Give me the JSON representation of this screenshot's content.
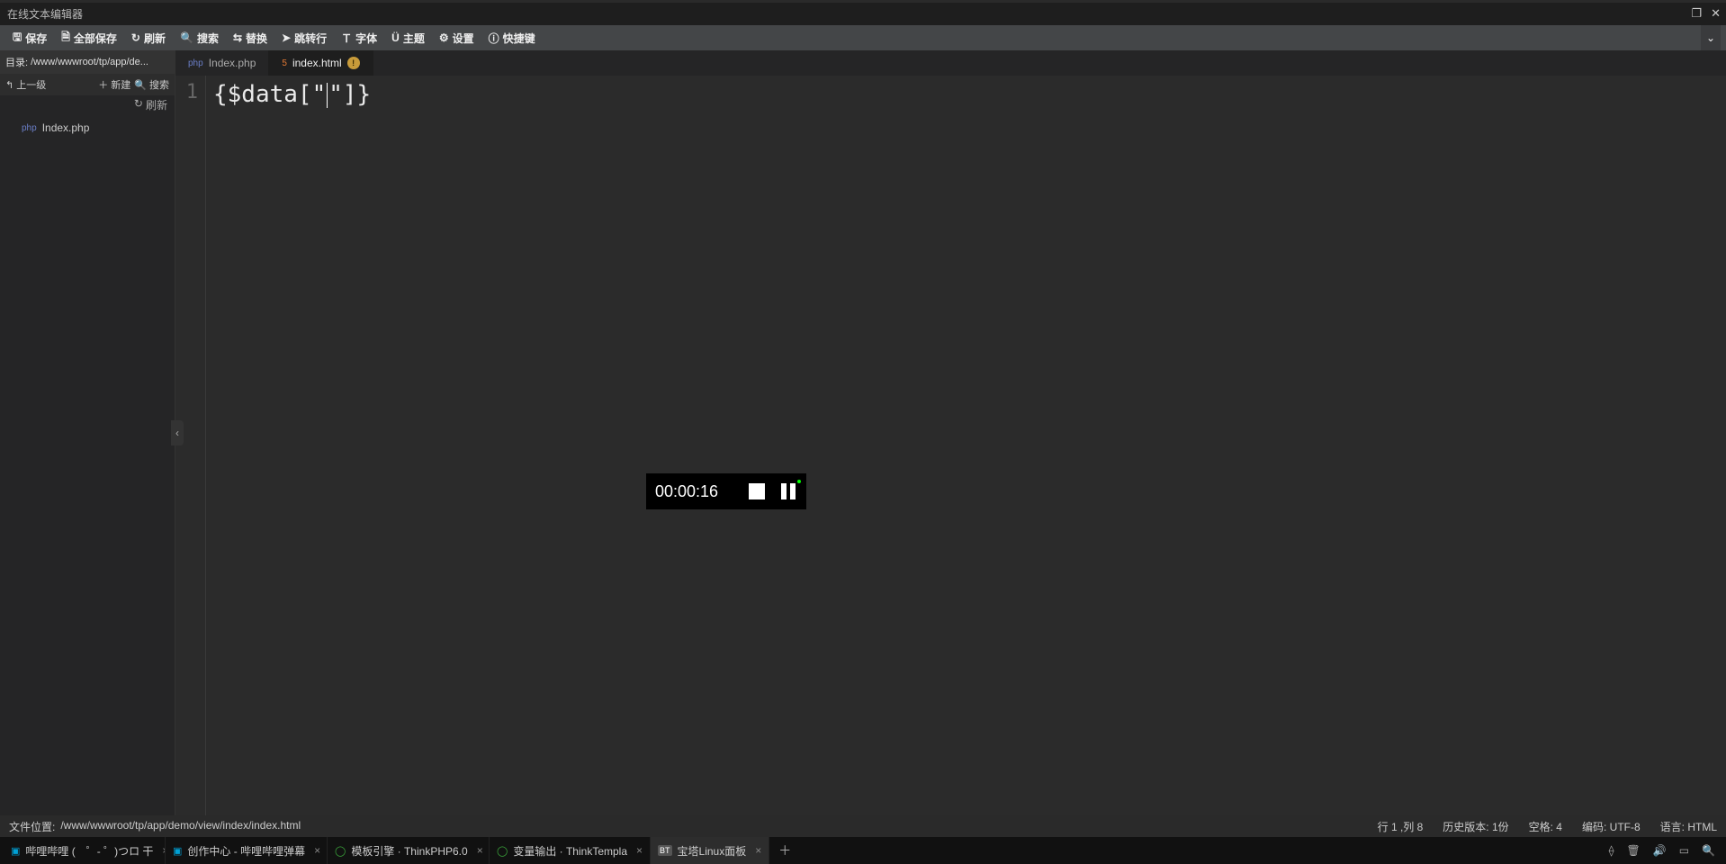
{
  "window": {
    "title": "在线文本编辑器"
  },
  "toolbar": {
    "save": "保存",
    "save_all": "全部保存",
    "refresh": "刷新",
    "search": "搜索",
    "replace": "替换",
    "goto": "跳转行",
    "font": "字体",
    "theme": "主题",
    "settings": "设置",
    "shortcuts": "快捷键"
  },
  "sidebar": {
    "dir_label": "目录:",
    "dir_path": "/www/wwwroot/tp/app/de...",
    "up": "上一级",
    "new": "新建",
    "search": "搜索",
    "refresh": "刷新",
    "files": [
      {
        "name": "Index.php",
        "type": "php"
      }
    ]
  },
  "tabs": [
    {
      "name": "Index.php",
      "type": "php",
      "active": false,
      "dirty": false
    },
    {
      "name": "index.html",
      "type": "html",
      "active": true,
      "dirty": true
    }
  ],
  "editor": {
    "lines": [
      {
        "num": "1",
        "text_before": "{$data[\"",
        "text_after": "\"]}"
      }
    ]
  },
  "recorder": {
    "time": "00:00:16"
  },
  "statusbar": {
    "file_loc_label": "文件位置:",
    "file_loc": "/www/wwwroot/tp/app/demo/view/index/index.html",
    "line_col": "行 1 ,列 8",
    "history": "历史版本: 1份",
    "spaces": "空格: 4",
    "encoding": "编码: UTF-8",
    "language": "语言: HTML"
  },
  "taskbar": {
    "tabs": [
      {
        "title": "哔哩哔哩 (　゜- ゜)つロ 干",
        "icon": "📺",
        "color": "#00a1d6",
        "active": false
      },
      {
        "title": "创作中心 - 哔哩哔哩弹幕",
        "icon": "📺",
        "color": "#00a1d6",
        "active": false
      },
      {
        "title": "模板引擎 · ThinkPHP6.0",
        "icon": "◯",
        "color": "#3ba93b",
        "active": false
      },
      {
        "title": "变量输出 · ThinkTempla",
        "icon": "◯",
        "color": "#3ba93b",
        "active": false
      },
      {
        "title": "宝塔Linux面板",
        "icon": "BT",
        "color": "#888",
        "active": true
      }
    ]
  }
}
